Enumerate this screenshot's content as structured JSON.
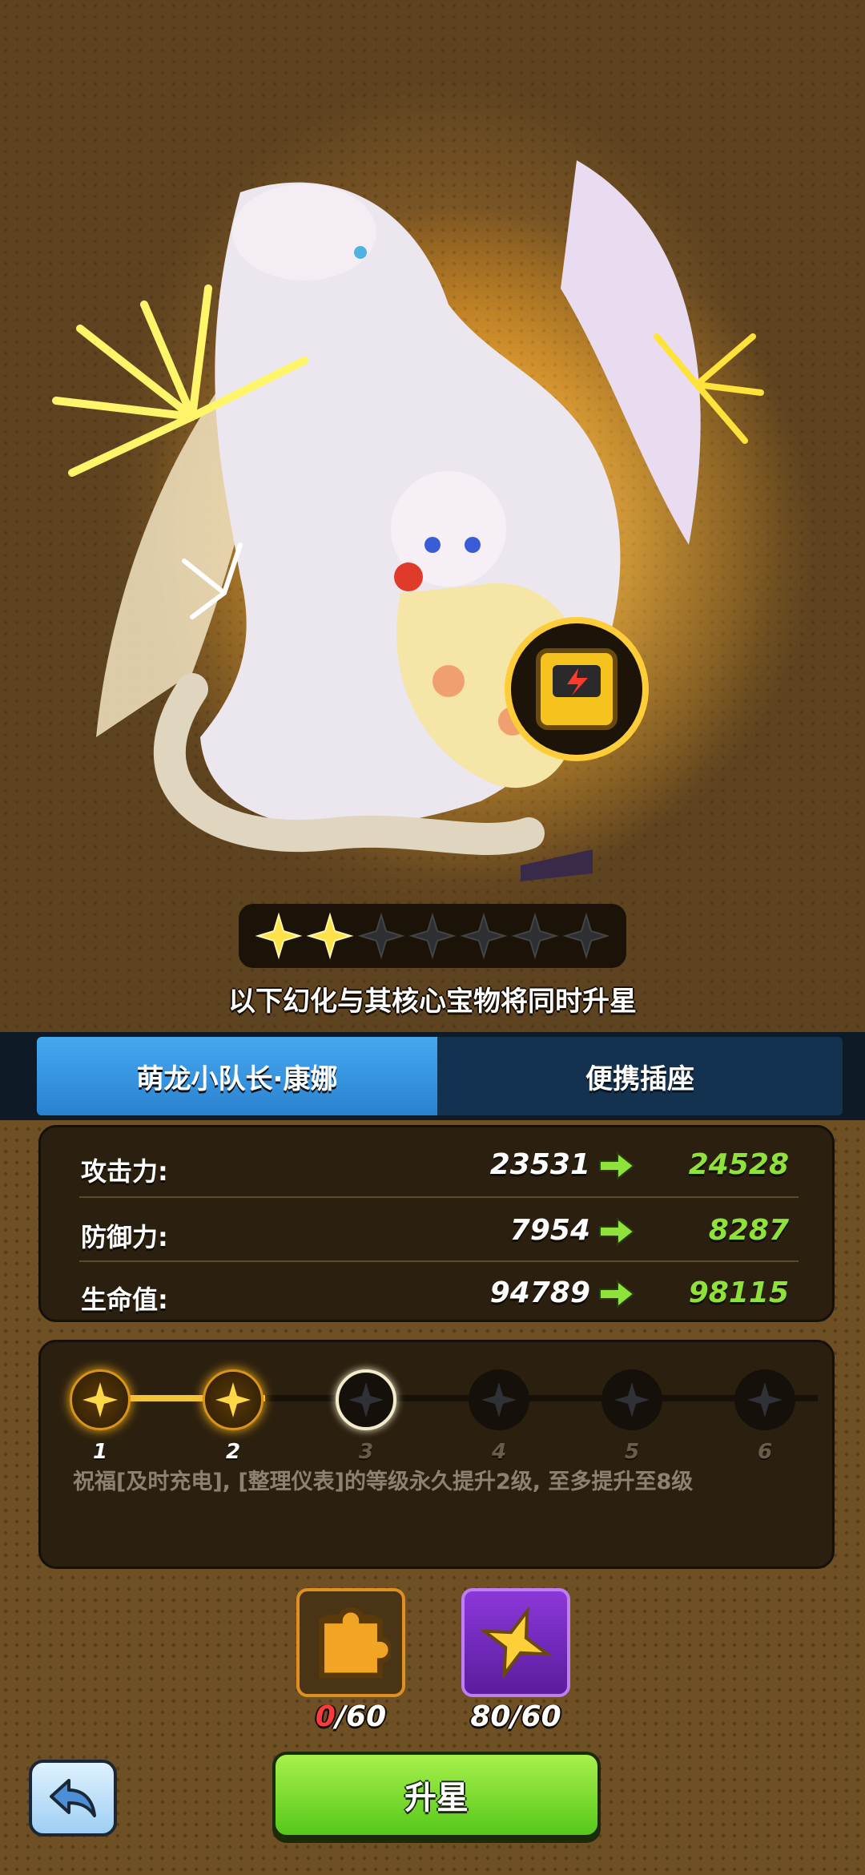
{
  "star_bar": {
    "total": 7,
    "filled": 2
  },
  "notice": "以下幻化与其核心宝物将同时升星",
  "tabs": [
    {
      "label": "萌龙小队长·康娜",
      "active": true
    },
    {
      "label": "便携插座",
      "active": false
    }
  ],
  "stats": [
    {
      "label": "攻击力:",
      "old": "23531",
      "new": "24528"
    },
    {
      "label": "防御力:",
      "old": "7954",
      "new": "8287"
    },
    {
      "label": "生命值:",
      "old": "94789",
      "new": "98115"
    }
  ],
  "star_track": {
    "nodes": [
      "1",
      "2",
      "3",
      "4",
      "5",
      "6"
    ],
    "lit": 2,
    "current": 3,
    "blessing": "祝福[及时充电], [整理仪表]的等级永久提升2级, 至多提升至8级"
  },
  "materials": [
    {
      "name": "portable-socket-piece",
      "have": "0",
      "need": "/60"
    },
    {
      "name": "star-crystal",
      "have": "80",
      "need": "/60"
    }
  ],
  "buttons": {
    "upgrade_label": "升星"
  },
  "colors": {
    "accent_green": "#8fe23a",
    "tab_active": "#3a96e0",
    "gold": "#f3c63a",
    "shortage_red": "#ff3a3a"
  }
}
